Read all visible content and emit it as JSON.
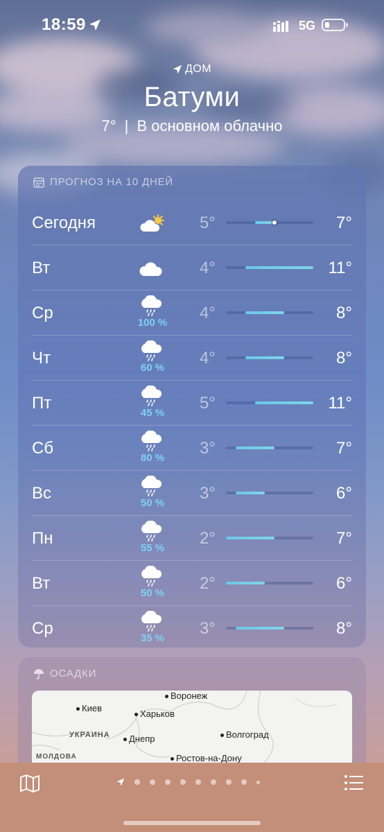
{
  "status": {
    "time": "18:59",
    "network": "5G"
  },
  "location": {
    "home_label": "ДОМ",
    "city": "Батуми",
    "temperature": "7°",
    "separator": "|",
    "condition": "В основном облачно"
  },
  "forecast": {
    "header": "ПРОГНОЗ НА 10 ДНЕЙ",
    "header_icon": "calendar-icon",
    "current_temp": 7,
    "scale": {
      "min": 2,
      "max": 11
    },
    "days": [
      {
        "day": "Сегодня",
        "icon": "partly-cloudy-sun-icon",
        "pop": "",
        "low": "5°",
        "high": "7°",
        "lo": 5,
        "hi": 7,
        "current": true
      },
      {
        "day": "Вт",
        "icon": "cloud-icon",
        "pop": "",
        "low": "4°",
        "high": "11°",
        "lo": 4,
        "hi": 11
      },
      {
        "day": "Ср",
        "icon": "cloud-rain-icon",
        "pop": "100 %",
        "low": "4°",
        "high": "8°",
        "lo": 4,
        "hi": 8
      },
      {
        "day": "Чт",
        "icon": "cloud-rain-icon",
        "pop": "60 %",
        "low": "4°",
        "high": "8°",
        "lo": 4,
        "hi": 8
      },
      {
        "day": "Пт",
        "icon": "cloud-rain-icon",
        "pop": "45 %",
        "low": "5°",
        "high": "11°",
        "lo": 5,
        "hi": 11
      },
      {
        "day": "Сб",
        "icon": "cloud-rain-icon",
        "pop": "80 %",
        "low": "3°",
        "high": "7°",
        "lo": 3,
        "hi": 7
      },
      {
        "day": "Вс",
        "icon": "cloud-rain-icon",
        "pop": "50 %",
        "low": "3°",
        "high": "6°",
        "lo": 3,
        "hi": 6
      },
      {
        "day": "Пн",
        "icon": "cloud-rain-icon",
        "pop": "55 %",
        "low": "2°",
        "high": "7°",
        "lo": 2,
        "hi": 7
      },
      {
        "day": "Вт",
        "icon": "cloud-rain-icon",
        "pop": "50 %",
        "low": "2°",
        "high": "6°",
        "lo": 2,
        "hi": 6
      },
      {
        "day": "Ср",
        "icon": "cloud-rain-icon",
        "pop": "35 %",
        "low": "3°",
        "high": "8°",
        "lo": 3,
        "hi": 8
      }
    ]
  },
  "precipitation": {
    "header": "ОСАДКИ",
    "header_icon": "umbrella-icon",
    "map_labels": {
      "voronezh": "Воронеж",
      "kiev": "Киев",
      "kharkov": "Харьков",
      "ukraine": "УКРАИНА",
      "dnepr": "Днепр",
      "volgograd": "Волгоград",
      "moldova": "МОЛДОВА",
      "rostov": "Ростов-на-Дону"
    }
  },
  "bottom_bar": {
    "map_icon": "map-icon",
    "list_icon": "list-icon",
    "page_count": 9,
    "active_page": 0
  },
  "colors": {
    "temp_bar": "#6cc8e8",
    "precip_text": "#7fd0f4",
    "bottom_bar": "#c38f79"
  }
}
